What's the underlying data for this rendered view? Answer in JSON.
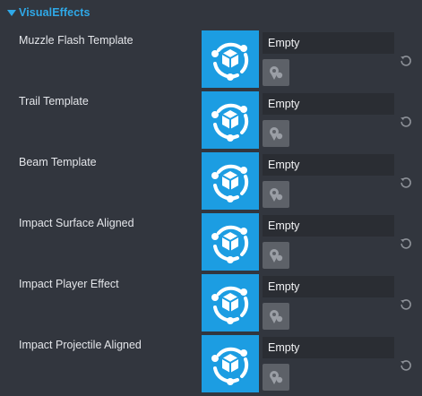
{
  "section": {
    "title": "VisualEffects",
    "expanded": true,
    "accent_color": "#2fa9e8"
  },
  "thumbnail_color": "#1c9de2",
  "icons": {
    "caret": "caret-down-icon",
    "thumbnail": "template-cube-icon",
    "pick": "asset-picker-icon",
    "reset": "reset-icon"
  },
  "properties": [
    {
      "label": "Muzzle Flash Template",
      "value": "Empty"
    },
    {
      "label": "Trail Template",
      "value": "Empty"
    },
    {
      "label": "Beam Template",
      "value": "Empty"
    },
    {
      "label": "Impact Surface Aligned",
      "value": "Empty"
    },
    {
      "label": "Impact Player Effect",
      "value": "Empty"
    },
    {
      "label": "Impact Projectile Aligned",
      "value": "Empty"
    }
  ]
}
